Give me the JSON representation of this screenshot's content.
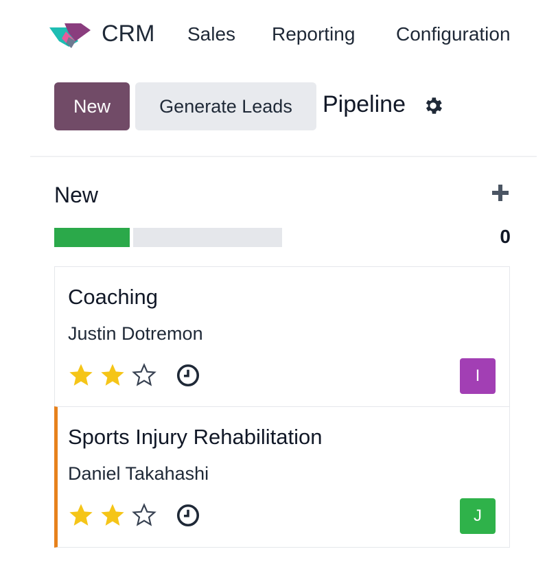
{
  "navbar": {
    "app_title": "CRM",
    "menu": [
      {
        "label": "Sales"
      },
      {
        "label": "Reporting"
      },
      {
        "label": "Configuration"
      }
    ]
  },
  "control_panel": {
    "new_button": "New",
    "generate_button": "Generate Leads",
    "breadcrumb": "Pipeline",
    "settings_icon": "gear-icon"
  },
  "column": {
    "title": "New",
    "count": "0",
    "progress_success_fraction": 0.33,
    "add_icon": "plus-icon"
  },
  "cards": [
    {
      "title": "Coaching",
      "contact": "Justin Dotremon",
      "stars": 2,
      "max_stars": 3,
      "activity_icon": "clock-icon",
      "avatar_initial": "I",
      "avatar_color": "#a23fb4"
    },
    {
      "title": "Sports Injury Rehabilitation",
      "contact": "Daniel Takahashi",
      "stars": 2,
      "max_stars": 3,
      "activity_icon": "clock-icon",
      "avatar_initial": "J",
      "avatar_color": "#2fb24a",
      "status_color": "#e7811c"
    }
  ],
  "colors": {
    "primary": "#714b67",
    "progress_success": "#2ba94a",
    "star_filled": "#f5c518"
  }
}
